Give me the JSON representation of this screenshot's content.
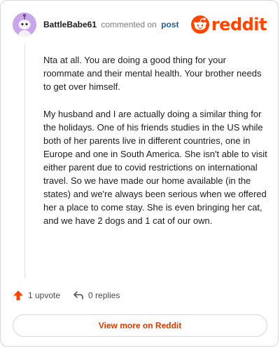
{
  "comment": {
    "username": "BattleBabe61",
    "action": "commented on",
    "post_link": "post",
    "avatar_icon": "snoo-avatar-icon",
    "paragraphs": [
      "Nta at all. You are doing a good thing for your roommate and their mental health. Your brother needs to get over himself.",
      "My husband and I are actually doing a similar thing for the holidays. One of his friends studies in the US while both of her parents live in different countries, one in Europe and one in South America. She isn't able to visit either parent due to covid restrictions on international travel. So we have made our home available (in the states) and we're always been serious when we offered her a place to come stay. She is even bringing her cat, and we have 2 dogs and 1 cat of our own."
    ]
  },
  "brand": {
    "wordmark": "reddit",
    "icon": "reddit-snoo-icon",
    "color": "#ff4500"
  },
  "footer": {
    "upvote_label": "1 upvote",
    "upvote_icon": "upvote-arrow-icon",
    "replies_label": "0 replies",
    "replies_icon": "reply-arrow-icon"
  },
  "view_more_label": "View more on Reddit",
  "colors": {
    "accent": "#d93a00",
    "link": "#1c5ea8",
    "avatar_bg": "#c7a6ea"
  }
}
